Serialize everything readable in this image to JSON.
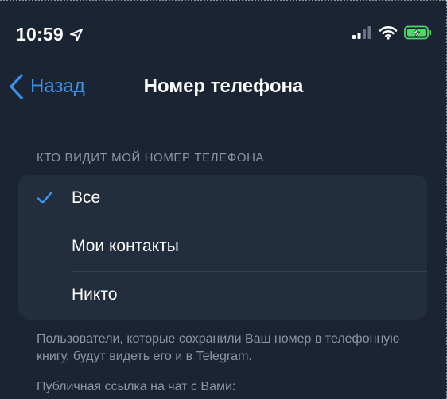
{
  "status_bar": {
    "time": "10:59",
    "location_icon": "location-arrow-icon",
    "signal_icon": "cellular-signal-icon",
    "wifi_icon": "wifi-icon",
    "battery_icon": "battery-charging-icon",
    "battery_color": "#4cd964"
  },
  "nav": {
    "back_label": "Назад",
    "title": "Номер телефона",
    "accent_color": "#3a8fe6"
  },
  "privacy": {
    "section_header": "КТО ВИДИТ МОЙ НОМЕР ТЕЛЕФОНА",
    "options": [
      {
        "label": "Все",
        "selected": true
      },
      {
        "label": "Мои контакты",
        "selected": false
      },
      {
        "label": "Никто",
        "selected": false
      }
    ],
    "footer_note": "Пользователи, которые сохранили Ваш номер в телефонную книгу, будут видеть его и в Telegram.",
    "public_link_label": "Публичная ссылка на чат с Вами:"
  }
}
